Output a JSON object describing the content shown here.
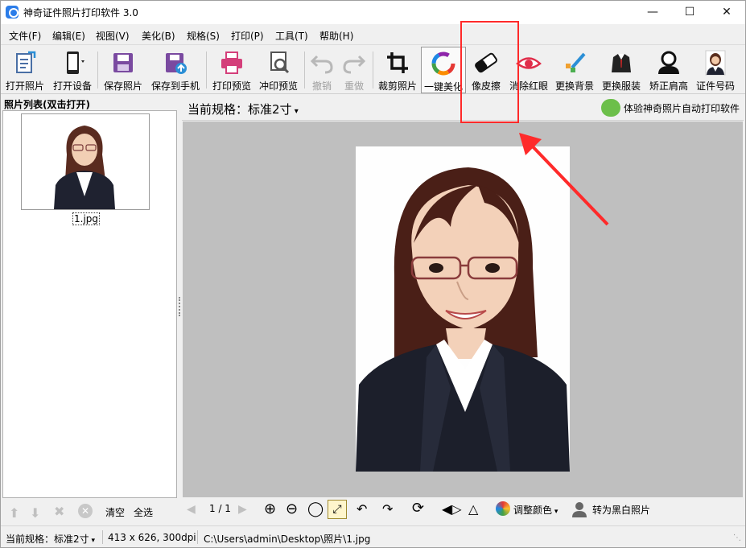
{
  "window": {
    "title": "神奇证件照片打印软件 3.0"
  },
  "menu": [
    "文件(F)",
    "编辑(E)",
    "视图(V)",
    "美化(B)",
    "规格(S)",
    "打印(P)",
    "工具(T)",
    "帮助(H)"
  ],
  "toolbar": {
    "open_photo": "打开照片",
    "open_device": "打开设备",
    "save_photo": "保存照片",
    "save_to_phone": "保存到手机",
    "print_preview": "打印预览",
    "develop_preview": "冲印预览",
    "undo": "撤销",
    "redo": "重做",
    "crop": "裁剪照片",
    "beautify": "一键美化",
    "eraser": "像皮擦",
    "red_eye": "消除红眼",
    "change_bg": "更换背景",
    "change_clothes": "更换服装",
    "shoulder": "矫正肩高",
    "id_number": "证件号码"
  },
  "left_panel": {
    "header": "照片列表(双击打开)",
    "thumb_name": "1.jpg",
    "clear": "清空",
    "select_all": "全选"
  },
  "right_panel": {
    "spec_label": "当前规格：标准2寸",
    "promo": "体验神奇照片自动打印软件"
  },
  "image_toolbar": {
    "page": "1 / 1",
    "adjust_color": "调整颜色",
    "to_bw": "转为黑白照片"
  },
  "status": {
    "spec_prefix": "当前规格：",
    "spec_value": "标准2寸",
    "size": "413 x 626, 300dpi",
    "path": "C:\\Users\\admin\\Desktop\\照片\\1.jpg"
  },
  "colors": {
    "annotation": "#ff2a2a",
    "canvas_bg": "#bfbfbf"
  }
}
